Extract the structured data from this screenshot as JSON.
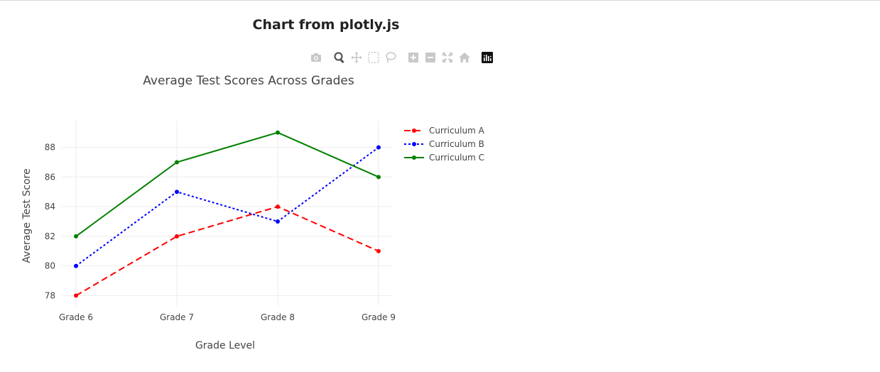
{
  "page": {
    "title": "Chart from plotly.js"
  },
  "modebar": {
    "buttons": [
      {
        "name": "camera-icon"
      },
      {
        "name": "zoom-icon"
      },
      {
        "name": "pan-icon"
      },
      {
        "name": "box-select-icon"
      },
      {
        "name": "lasso-select-icon"
      },
      {
        "name": "zoom-in-icon"
      },
      {
        "name": "zoom-out-icon"
      },
      {
        "name": "autoscale-icon"
      },
      {
        "name": "home-icon"
      },
      {
        "name": "plotly-logo-icon"
      }
    ]
  },
  "chart_data": {
    "type": "line",
    "title": "Average Test Scores Across Grades",
    "xlabel": "Grade Level",
    "ylabel": "Average Test Score",
    "categories": [
      "Grade 6",
      "Grade 7",
      "Grade 8",
      "Grade 9"
    ],
    "ylim": [
      77.3,
      89.8
    ],
    "yticks": [
      78,
      80,
      82,
      84,
      86,
      88
    ],
    "grid": true,
    "legend_position": "top-right",
    "series": [
      {
        "name": "Curriculum A",
        "values": [
          78,
          82,
          84,
          81
        ],
        "color": "#ff0000",
        "dash": "dash"
      },
      {
        "name": "Curriculum B",
        "values": [
          80,
          85,
          83,
          88
        ],
        "color": "#0000ff",
        "dash": "dot"
      },
      {
        "name": "Curriculum C",
        "values": [
          82,
          87,
          89,
          86
        ],
        "color": "#008000",
        "dash": "solid"
      }
    ]
  }
}
